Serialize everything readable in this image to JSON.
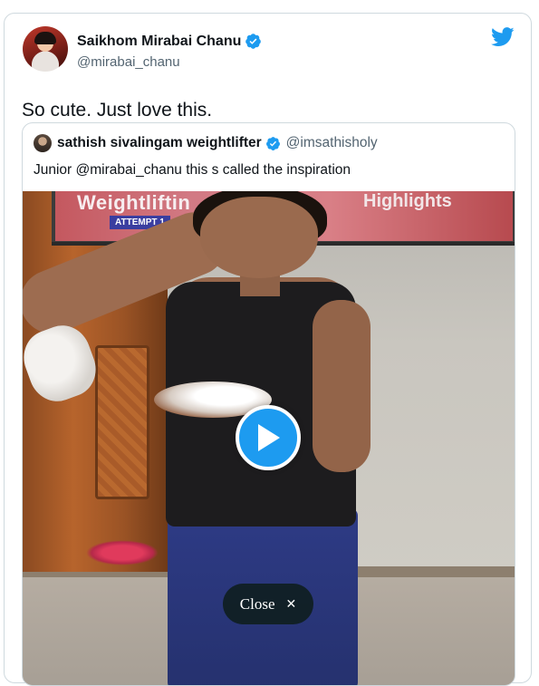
{
  "tweet": {
    "author": {
      "display_name": "Saikhom Mirabai Chanu",
      "handle": "@mirabai_chanu",
      "verified": true
    },
    "text": "So cute. Just love this.",
    "brand_icon": "twitter-bird-icon",
    "accent_color": "#1d9bf0"
  },
  "quoted_tweet": {
    "author": {
      "display_name": "sathish sivalingam weightlifter",
      "handle": "@imsathisholy",
      "verified": true
    },
    "text": "Junior @mirabai_chanu this s called the inspiration",
    "media": {
      "type": "video",
      "tv_overlay_title": "Weightliftin",
      "tv_overlay_sub": "ATTEMPT 1",
      "tv_overlay_right": "Highlights",
      "play_icon": "play-icon",
      "close_label": "Close",
      "close_icon": "close-icon"
    }
  }
}
